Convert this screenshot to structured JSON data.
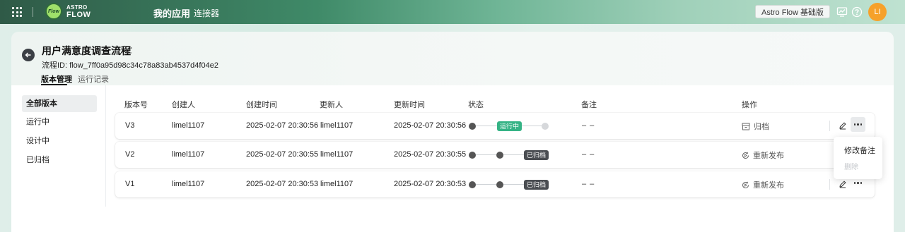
{
  "topbar": {
    "logo_badge": "Flow",
    "logo_line1": "ASTRO",
    "logo_line2": "FLOW",
    "nav": [
      {
        "label": "我的应用",
        "active": true
      },
      {
        "label": "连接器",
        "active": false
      }
    ],
    "plan_label": "Astro Flow 基础版",
    "avatar_initials": "LI",
    "icons": [
      "grid-icon",
      "monitor-chart-icon",
      "help-icon"
    ]
  },
  "header": {
    "title": "用户满意度调查流程",
    "flow_id": "流程ID: flow_7ff0a95d98c34c78a83ab4537d4f04e2",
    "tabs": [
      {
        "label": "版本管理",
        "active": true
      },
      {
        "label": "运行记录",
        "active": false
      }
    ]
  },
  "sidebar": {
    "items": [
      {
        "label": "全部版本",
        "active": true
      },
      {
        "label": "运行中",
        "active": false
      },
      {
        "label": "设计中",
        "active": false
      },
      {
        "label": "已归档",
        "active": false
      }
    ]
  },
  "table": {
    "columns": [
      "版本号",
      "创建人",
      "创建时间",
      "更新人",
      "更新时间",
      "状态",
      "备注",
      "操作"
    ],
    "rows": [
      {
        "version": "V3",
        "creator": "limel1107",
        "created": "2025-02-07 20:30:56",
        "updater": "limel1107",
        "updated": "2025-02-07 20:30:56",
        "status": "运行中",
        "note": "– –",
        "action": "归档"
      },
      {
        "version": "V2",
        "creator": "limel1107",
        "created": "2025-02-07 20:30:55",
        "updater": "limel1107",
        "updated": "2025-02-07 20:30:55",
        "status": "已归档",
        "note": "– –",
        "action": "重新发布"
      },
      {
        "version": "V1",
        "creator": "limel1107",
        "created": "2025-02-07 20:30:53",
        "updater": "limel1107",
        "updated": "2025-02-07 20:30:53",
        "status": "已归档",
        "note": "– –",
        "action": "重新发布"
      }
    ]
  },
  "dropdown": {
    "items": [
      {
        "label": "修改备注",
        "disabled": false
      },
      {
        "label": "删除",
        "disabled": true
      }
    ]
  },
  "colors": {
    "running": "#35b385",
    "archived": "#4a4d52",
    "avatar": "#f6a12a"
  }
}
